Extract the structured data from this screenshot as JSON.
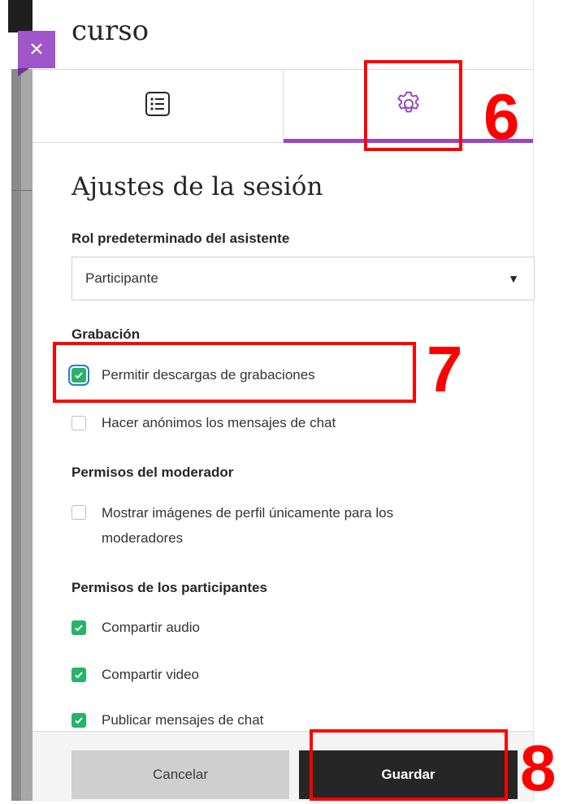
{
  "panel": {
    "title": "curso",
    "close_icon": "×"
  },
  "tabs": [
    {
      "name": "details",
      "icon": "list-icon",
      "selected": false
    },
    {
      "name": "settings",
      "icon": "gear-icon",
      "selected": true
    }
  ],
  "settings": {
    "heading": "Ajustes de la sesión",
    "role_label": "Rol predeterminado del asistente",
    "role_value": "Participante",
    "recording_heading": "Grabación",
    "recording_options": [
      {
        "label": "Permitir descargas de grabaciones",
        "checked": true
      },
      {
        "label": "Hacer anónimos los mensajes de chat",
        "checked": false
      }
    ],
    "moderator_heading": "Permisos del moderador",
    "moderator_options": [
      {
        "label": "Mostrar imágenes de perfil únicamente para los moderadores",
        "checked": false
      }
    ],
    "participant_heading": "Permisos de los participantes",
    "participant_options": [
      {
        "label": "Compartir audio",
        "checked": true
      },
      {
        "label": "Compartir video",
        "checked": true
      },
      {
        "label": "Publicar mensajes de chat",
        "checked": true
      }
    ]
  },
  "footer": {
    "cancel_label": "Cancelar",
    "save_label": "Guardar"
  },
  "annotations": {
    "step6": "6",
    "step7": "7",
    "step8": "8"
  },
  "colors": {
    "accent_purple": "#9b45c2",
    "check_green": "#27b36a",
    "annotation_red": "#ff0000",
    "save_button": "#262626"
  }
}
